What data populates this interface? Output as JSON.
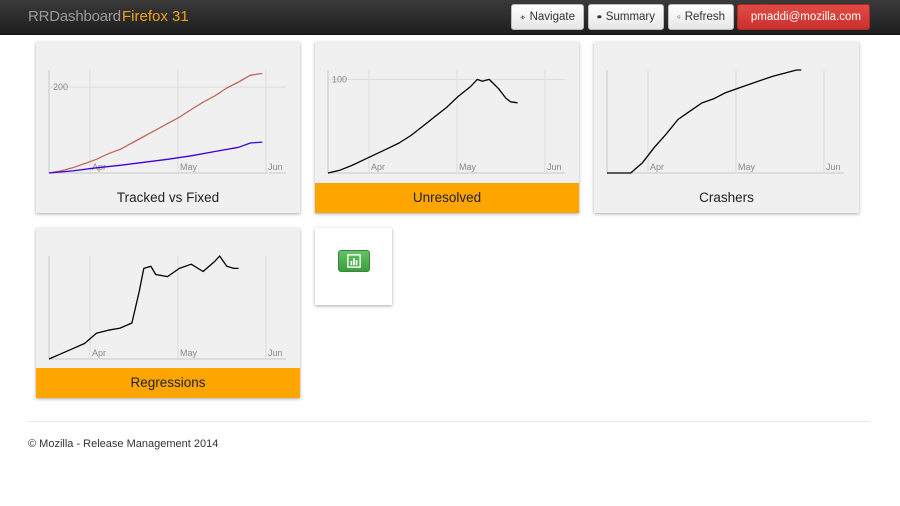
{
  "navbar": {
    "brand": "RRDashboard",
    "product": "Firefox 31",
    "buttons": {
      "navigate": "Navigate",
      "summary": "Summary",
      "refresh": "Refresh",
      "user": "pmaddi@mozilla.com"
    }
  },
  "icons": {
    "navigate": "plane-icon",
    "summary": "comment-icon",
    "refresh": "refresh-icon",
    "user": "sign-out-icon",
    "add": "bar-chart-icon"
  },
  "colors": {
    "alert": "#ffa500",
    "brand_accent": "#f0a21c",
    "user_button": "#d9534f",
    "add_button": "#5cb85c",
    "series_tracked": "#c0685e",
    "series_fixed": "#3b00e0",
    "series_default": "#000000"
  },
  "tiles": [
    {
      "title": "Tracked vs Fixed",
      "alert": false
    },
    {
      "title": "Unresolved",
      "alert": true
    },
    {
      "title": "Crashers",
      "alert": false
    },
    {
      "title": "Regressions",
      "alert": true
    }
  ],
  "chart_data": [
    {
      "type": "line",
      "title": "Tracked vs Fixed",
      "x_ticks": [
        "Apr",
        "May",
        "Jun"
      ],
      "y_ticks": [
        200
      ],
      "xlim": [
        0,
        100
      ],
      "ylim": [
        0,
        240
      ],
      "series": [
        {
          "color": "#c0685e",
          "x": [
            0,
            5,
            10,
            15,
            20,
            25,
            30,
            35,
            40,
            45,
            50,
            55,
            60,
            65,
            70,
            75,
            80,
            85,
            90
          ],
          "y": [
            0,
            5,
            12,
            22,
            32,
            45,
            55,
            70,
            85,
            100,
            115,
            130,
            148,
            165,
            180,
            198,
            212,
            228,
            232
          ]
        },
        {
          "color": "#3b00e0",
          "x": [
            0,
            10,
            20,
            30,
            40,
            50,
            60,
            70,
            80,
            85,
            90
          ],
          "y": [
            0,
            5,
            12,
            18,
            25,
            32,
            40,
            50,
            60,
            70,
            72
          ]
        }
      ]
    },
    {
      "type": "line",
      "title": "Unresolved",
      "x_ticks": [
        "Apr",
        "May",
        "Jun"
      ],
      "y_ticks": [
        100
      ],
      "xlim": [
        0,
        100
      ],
      "ylim": [
        0,
        110
      ],
      "series": [
        {
          "color": "#000000",
          "x": [
            0,
            5,
            10,
            15,
            20,
            25,
            30,
            35,
            40,
            45,
            50,
            55,
            60,
            63,
            65,
            68,
            70,
            72,
            75,
            77,
            80
          ],
          "y": [
            0,
            3,
            8,
            14,
            20,
            26,
            32,
            40,
            50,
            60,
            70,
            82,
            92,
            100,
            98,
            100,
            95,
            90,
            80,
            76,
            75
          ]
        }
      ]
    },
    {
      "type": "line",
      "title": "Crashers",
      "x_ticks": [
        "Apr",
        "May",
        "Jun"
      ],
      "y_ticks": [],
      "xlim": [
        0,
        100
      ],
      "ylim": [
        0,
        100
      ],
      "series": [
        {
          "color": "#000000",
          "x": [
            0,
            10,
            15,
            20,
            25,
            30,
            35,
            40,
            45,
            50,
            55,
            60,
            65,
            70,
            75,
            80,
            82
          ],
          "y": [
            0,
            0,
            10,
            25,
            38,
            52,
            60,
            68,
            72,
            78,
            82,
            86,
            90,
            94,
            97,
            100,
            100
          ]
        }
      ]
    },
    {
      "type": "line",
      "title": "Regressions",
      "x_ticks": [
        "Apr",
        "May",
        "Jun"
      ],
      "y_ticks": [],
      "xlim": [
        0,
        100
      ],
      "ylim": [
        0,
        100
      ],
      "series": [
        {
          "color": "#000000",
          "x": [
            0,
            5,
            10,
            15,
            20,
            25,
            30,
            35,
            38,
            40,
            43,
            45,
            50,
            55,
            60,
            65,
            70,
            72,
            75,
            78,
            80
          ],
          "y": [
            0,
            5,
            10,
            15,
            25,
            28,
            30,
            35,
            65,
            88,
            90,
            82,
            80,
            88,
            92,
            85,
            95,
            100,
            90,
            88,
            88
          ]
        }
      ]
    }
  ],
  "footer": {
    "text": "© Mozilla - Release Management 2014"
  }
}
